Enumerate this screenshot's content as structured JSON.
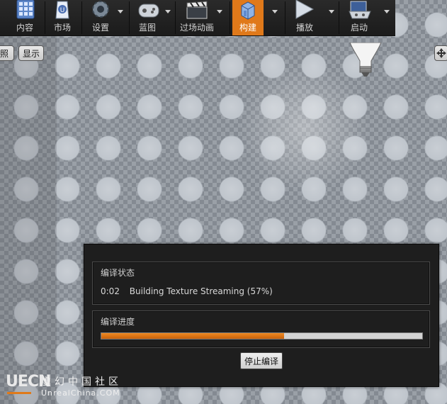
{
  "toolbar": {
    "buttons": [
      {
        "label": "内容",
        "icon": "content-browser-icon"
      },
      {
        "label": "市场",
        "icon": "marketplace-icon"
      },
      {
        "label": "设置",
        "icon": "settings-icon"
      },
      {
        "label": "蓝图",
        "icon": "blueprint-icon"
      },
      {
        "label": "过场动画",
        "icon": "cinematics-icon"
      },
      {
        "label": "构建",
        "icon": "build-icon",
        "active": true
      },
      {
        "label": "播放",
        "icon": "play-icon"
      },
      {
        "label": "启动",
        "icon": "launch-icon"
      }
    ],
    "accent_color": "#e0791a"
  },
  "viewport": {
    "lit_button_label": "照",
    "show_button_label": "显示"
  },
  "compile_dialog": {
    "status_title": "编译状态",
    "status_time": "0:02",
    "status_text": "Building Texture Streaming (57%)",
    "progress_title": "编译进度",
    "progress_fraction": 0.57,
    "stop_button_label": "停止编译"
  },
  "watermark": {
    "logo_text": "UECN",
    "chinese_text": "虚幻中国社区",
    "site_text": "UnrealChina.COM"
  }
}
